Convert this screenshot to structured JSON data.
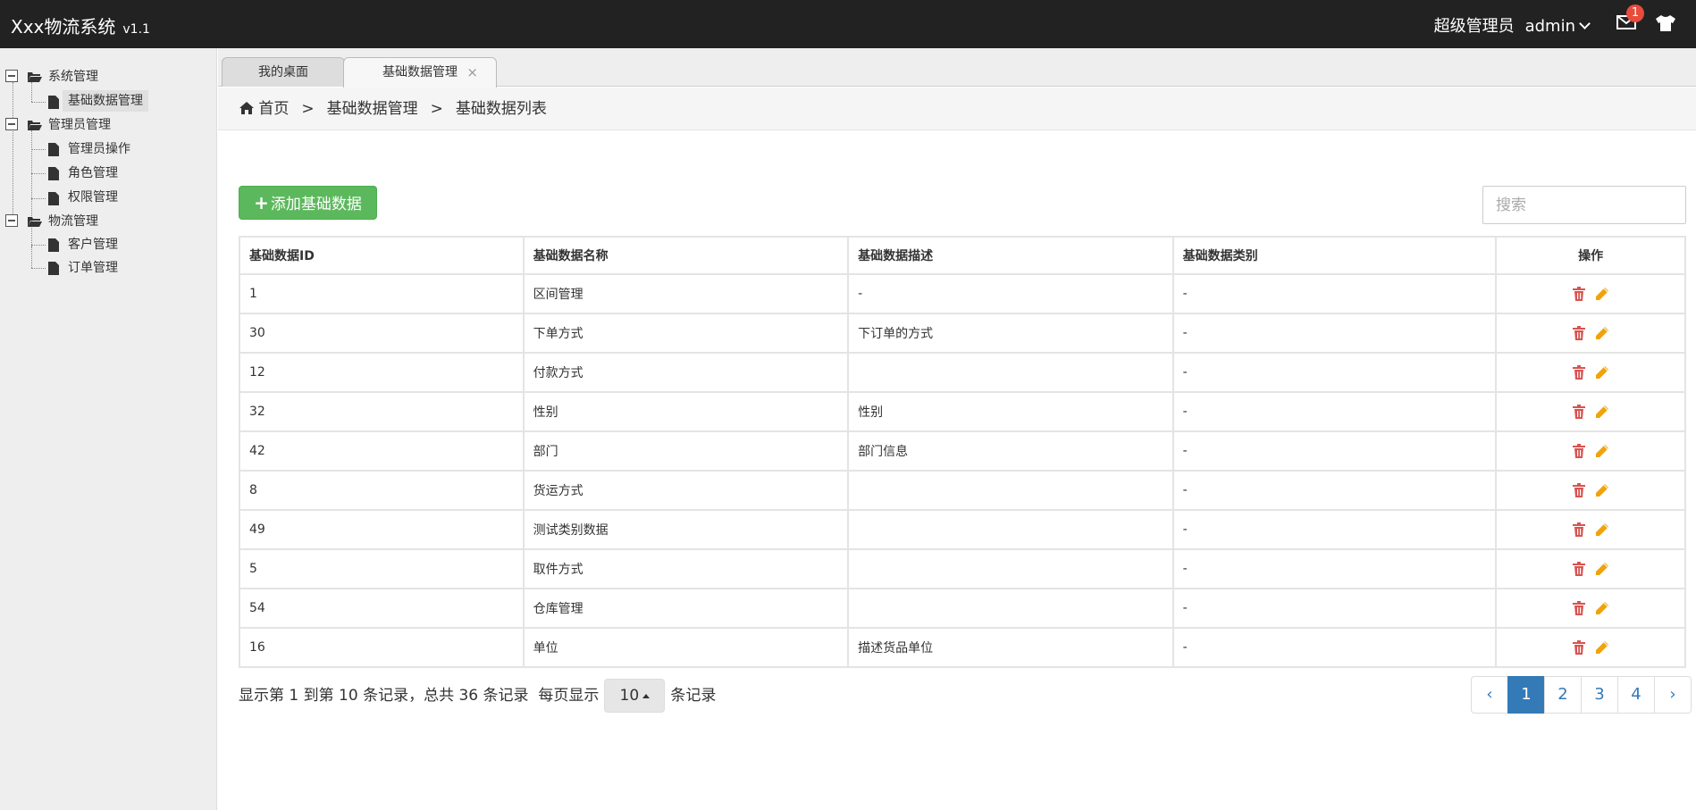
{
  "app": {
    "title": "Xxx物流系统",
    "version": "v1.1"
  },
  "header": {
    "role": "超级管理员",
    "username": "admin",
    "mail_count": "1"
  },
  "sidebar": {
    "groups": [
      {
        "label": "系统管理",
        "items": [
          {
            "label": "基础数据管理",
            "selected": true
          }
        ]
      },
      {
        "label": "管理员管理",
        "items": [
          {
            "label": "管理员操作"
          },
          {
            "label": "角色管理"
          },
          {
            "label": "权限管理"
          }
        ]
      },
      {
        "label": "物流管理",
        "items": [
          {
            "label": "客户管理"
          },
          {
            "label": "订单管理"
          }
        ]
      }
    ]
  },
  "tabs": [
    {
      "label": "我的桌面",
      "active": false
    },
    {
      "label": "基础数据管理",
      "active": true,
      "close": "×"
    }
  ],
  "breadcrumb": {
    "home": "首页",
    "sep": ">",
    "level1": "基础数据管理",
    "level2": "基础数据列表"
  },
  "toolbar": {
    "add_label": "添加基础数据",
    "search_placeholder": "搜索"
  },
  "table": {
    "columns": [
      "基础数据ID",
      "基础数据名称",
      "基础数据描述",
      "基础数据类别",
      "操作"
    ],
    "rows": [
      {
        "id": "1",
        "name": "区间管理",
        "desc": "-",
        "cat": "-"
      },
      {
        "id": "30",
        "name": "下单方式",
        "desc": "下订单的方式",
        "cat": "-"
      },
      {
        "id": "12",
        "name": "付款方式",
        "desc": "",
        "cat": "-"
      },
      {
        "id": "32",
        "name": "性别",
        "desc": "性别",
        "cat": "-"
      },
      {
        "id": "42",
        "name": "部门",
        "desc": "部门信息",
        "cat": "-"
      },
      {
        "id": "8",
        "name": "货运方式",
        "desc": "",
        "cat": "-"
      },
      {
        "id": "49",
        "name": "测试类别数据",
        "desc": "",
        "cat": "-"
      },
      {
        "id": "5",
        "name": "取件方式",
        "desc": "",
        "cat": "-"
      },
      {
        "id": "54",
        "name": "仓库管理",
        "desc": "",
        "cat": "-"
      },
      {
        "id": "16",
        "name": "单位",
        "desc": "描述货品单位",
        "cat": "-"
      }
    ]
  },
  "pagination": {
    "info_prefix": "显示第 1 到第 10 条记录，总共 36 条记录",
    "per_page_label": "每页显示",
    "per_page": "10",
    "per_page_suffix": "条记录",
    "pages": [
      "‹",
      "1",
      "2",
      "3",
      "4",
      "›"
    ],
    "current": "1"
  },
  "colors": {
    "topbar": "#222222",
    "add_button": "#5cb85c",
    "delete_icon": "#d9534f",
    "edit_icon": "#f0a30a",
    "page_active": "#337ab7"
  },
  "icons": {
    "home": "home-icon",
    "mail": "mail-icon",
    "shirt": "shirt-icon",
    "folder": "folder-open-icon",
    "file": "file-icon",
    "delete": "trash-icon",
    "edit": "pencil-icon"
  }
}
